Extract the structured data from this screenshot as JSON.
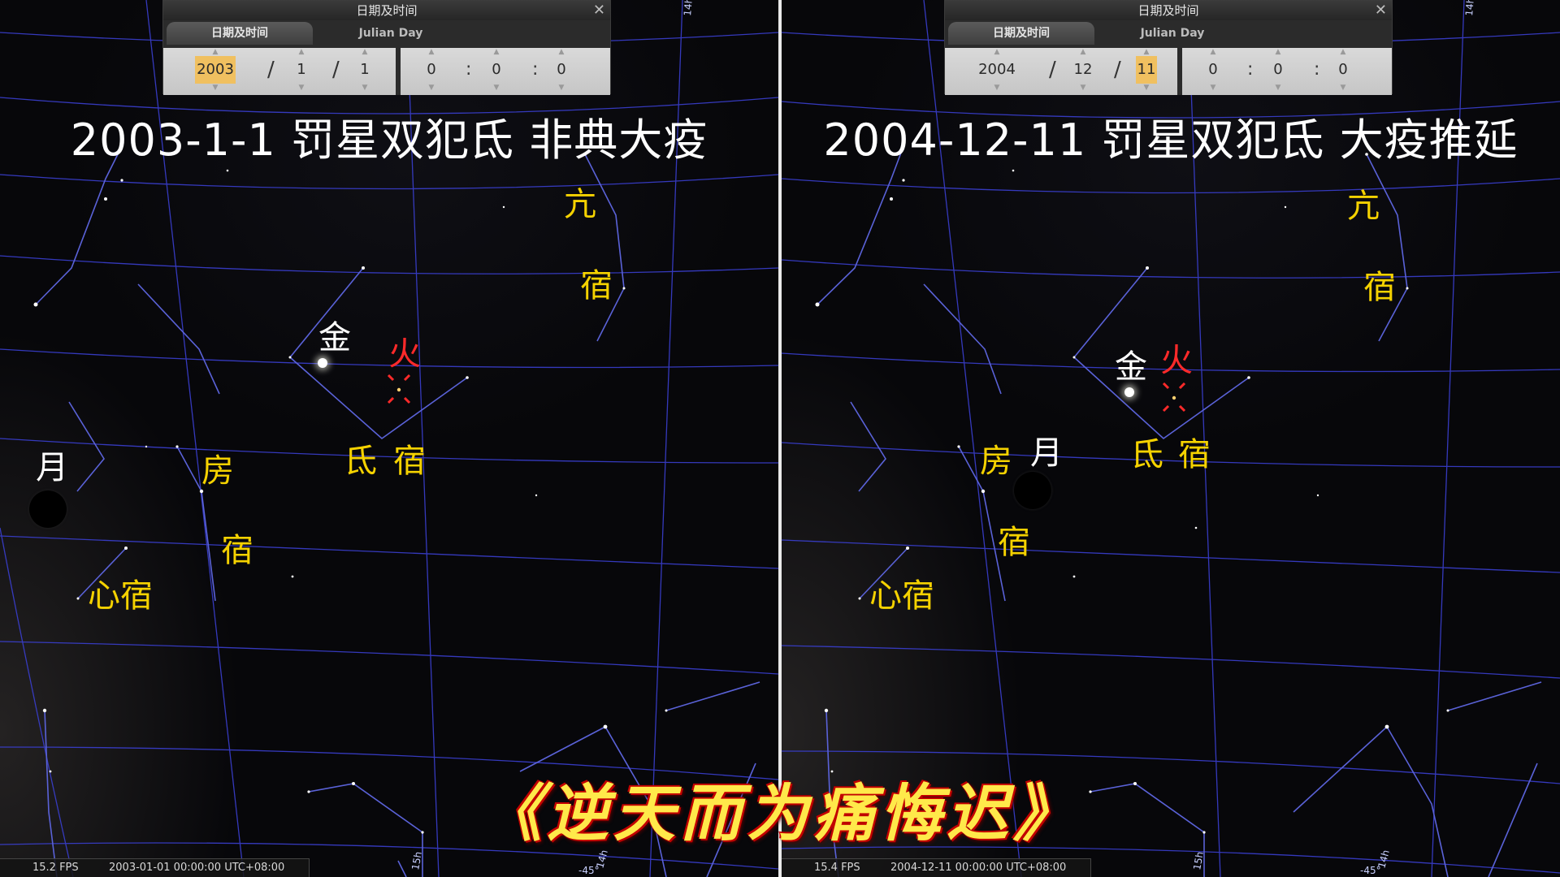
{
  "panels": [
    {
      "id": "left",
      "dialog": {
        "title": "日期及时间",
        "tab_datetime": "日期及时间",
        "tab_julian": "Julian Day",
        "year": "2003",
        "month": "1",
        "day": "1",
        "hour": "0",
        "minute": "0",
        "second": "0",
        "date_sep": "/",
        "time_sep": ":",
        "close": "✕"
      },
      "heading": "2003-1-1 罚星双犯氐 非典大疫",
      "labels": {
        "kang_1": "亢",
        "kang_2": "宿",
        "jin": "金",
        "huo": "火",
        "di_1": "氐",
        "di_2": "宿",
        "yue": "月",
        "fang_1": "房",
        "fang_2": "宿",
        "xin": "心宿"
      },
      "status": {
        "fps": "15.2 FPS",
        "datetime": "2003-01-01   00:00:00 UTC+08:00"
      },
      "grid_labels": {
        "ra_top": "14h",
        "ra_bottom_1": "15h",
        "ra_bottom_2": "-45°",
        "ra_bottom_3": "14h"
      }
    },
    {
      "id": "right",
      "dialog": {
        "title": "日期及时间",
        "tab_datetime": "日期及时间",
        "tab_julian": "Julian Day",
        "year": "2004",
        "month": "12",
        "day": "11",
        "hour": "0",
        "minute": "0",
        "second": "0",
        "date_sep": "/",
        "time_sep": ":",
        "close": "✕"
      },
      "heading": "2004-12-11 罚星双犯氐 大疫推延",
      "labels": {
        "kang_1": "亢",
        "kang_2": "宿",
        "jin": "金",
        "huo": "火",
        "di_1": "氐",
        "di_2": "宿",
        "yue": "月",
        "fang_1": "房",
        "fang_2": "宿",
        "xin": "心宿"
      },
      "status": {
        "fps": "15.4 FPS",
        "datetime": "2004-12-11   00:00:00 UTC+08:00"
      },
      "grid_labels": {
        "ra_top": "14h",
        "ra_bottom_1": "15h",
        "ra_bottom_2": "-45°",
        "ra_bottom_3": "14h"
      }
    }
  ],
  "caption": "《逆天而为痛悔迟》",
  "colors": {
    "grid": "#3a3fd0",
    "constellation": "#5a62d8",
    "label_yellow": "#f5d200",
    "label_red": "#ff2a2a",
    "caption_fill": "#ffe94a",
    "caption_outline": "#c20000"
  }
}
